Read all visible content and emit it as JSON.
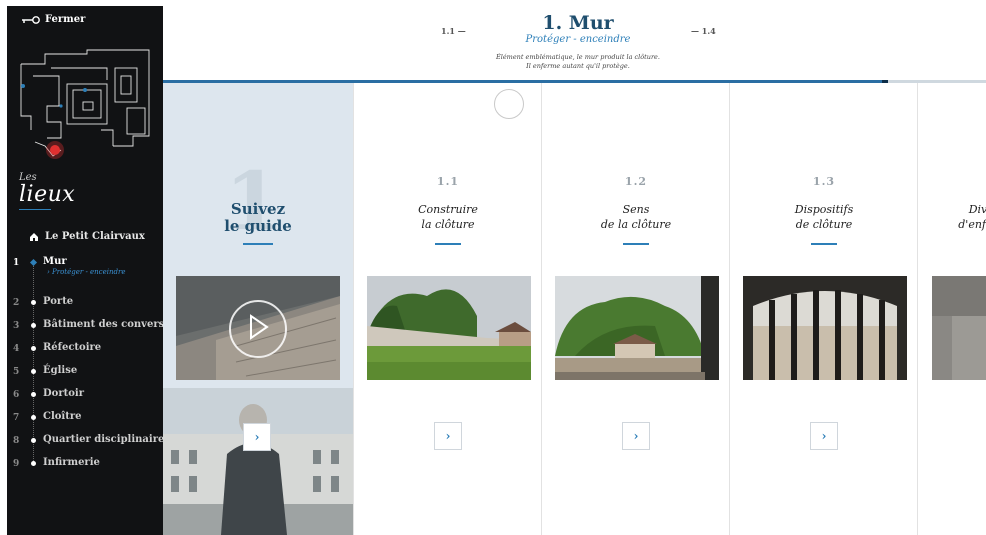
{
  "sidebar": {
    "close_label": "Fermer",
    "les": "Les",
    "lieux": "lieux",
    "petit_clairvaux": "Le Petit Clairvaux",
    "items": [
      {
        "num": "1",
        "label": "Mur",
        "sub": "› Protéger - enceindre"
      },
      {
        "num": "2",
        "label": "Porte"
      },
      {
        "num": "3",
        "label": "Bâtiment des convers"
      },
      {
        "num": "4",
        "label": "Réfectoire"
      },
      {
        "num": "5",
        "label": "Église"
      },
      {
        "num": "6",
        "label": "Dortoir"
      },
      {
        "num": "7",
        "label": "Cloître"
      },
      {
        "num": "8",
        "label": "Quartier disciplinaire"
      },
      {
        "num": "9",
        "label": "Infirmerie"
      }
    ]
  },
  "header": {
    "prev": "1.1 —",
    "next": "— 1.4",
    "title": "1. Mur",
    "subtitle": "Protéger - enceindre",
    "desc_line1": "Élément emblématique, le mur produit la clôture.",
    "desc_line2": "Il enferme autant qu'il protège."
  },
  "progress": {
    "fraction": 0.88
  },
  "guide": {
    "big_number": "1",
    "title_line1": "Suivez",
    "title_line2": "le guide",
    "button": "›"
  },
  "columns": [
    {
      "num": "1.1",
      "title_line1": "Construire",
      "title_line2": "la clôture",
      "button": "›"
    },
    {
      "num": "1.2",
      "title_line1": "Sens",
      "title_line2": "de la clôture",
      "button": "›"
    },
    {
      "num": "1.3",
      "title_line1": "Dispositifs",
      "title_line2": "de clôture",
      "button": "›"
    },
    {
      "num": "",
      "title_line1": "Div",
      "title_line2": "d'enfer",
      "button": ""
    }
  ],
  "colors": {
    "accent": "#2d7fb8",
    "title": "#1f4e6e",
    "sidebar_bg": "#111214"
  }
}
